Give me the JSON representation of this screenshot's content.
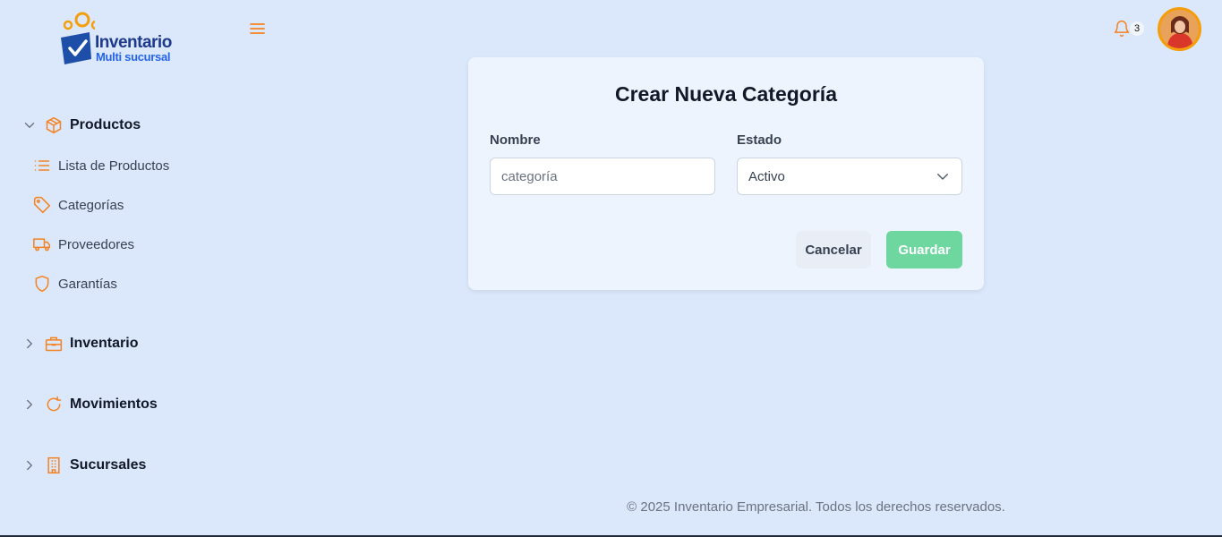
{
  "logo": {
    "title": "Inventario",
    "subtitle": "Multi sucursal"
  },
  "header": {
    "notification_count": "3"
  },
  "sidebar": {
    "groups": [
      {
        "label": "Productos",
        "icon": "box-icon",
        "expanded": true,
        "items": [
          {
            "label": "Lista de Productos",
            "icon": "list-icon"
          },
          {
            "label": "Categorías",
            "icon": "tag-icon"
          },
          {
            "label": "Proveedores",
            "icon": "truck-icon"
          },
          {
            "label": "Garantías",
            "icon": "shield-icon"
          }
        ]
      },
      {
        "label": "Inventario",
        "icon": "briefcase-icon",
        "expanded": false
      },
      {
        "label": "Movimientos",
        "icon": "refresh-icon",
        "expanded": false
      },
      {
        "label": "Sucursales",
        "icon": "building-icon",
        "expanded": false
      }
    ]
  },
  "form": {
    "title": "Crear Nueva Categoría",
    "name_label": "Nombre",
    "name_placeholder": "categoría",
    "status_label": "Estado",
    "status_value": "Activo",
    "cancel_label": "Cancelar",
    "save_label": "Guardar"
  },
  "footer": {
    "text": "© 2025 Inventario Empresarial. Todos los derechos reservados."
  },
  "colors": {
    "accent": "#f58220",
    "background": "#dbe8fb",
    "save": "#6ed7a0",
    "brand": "#1e3a8a"
  }
}
